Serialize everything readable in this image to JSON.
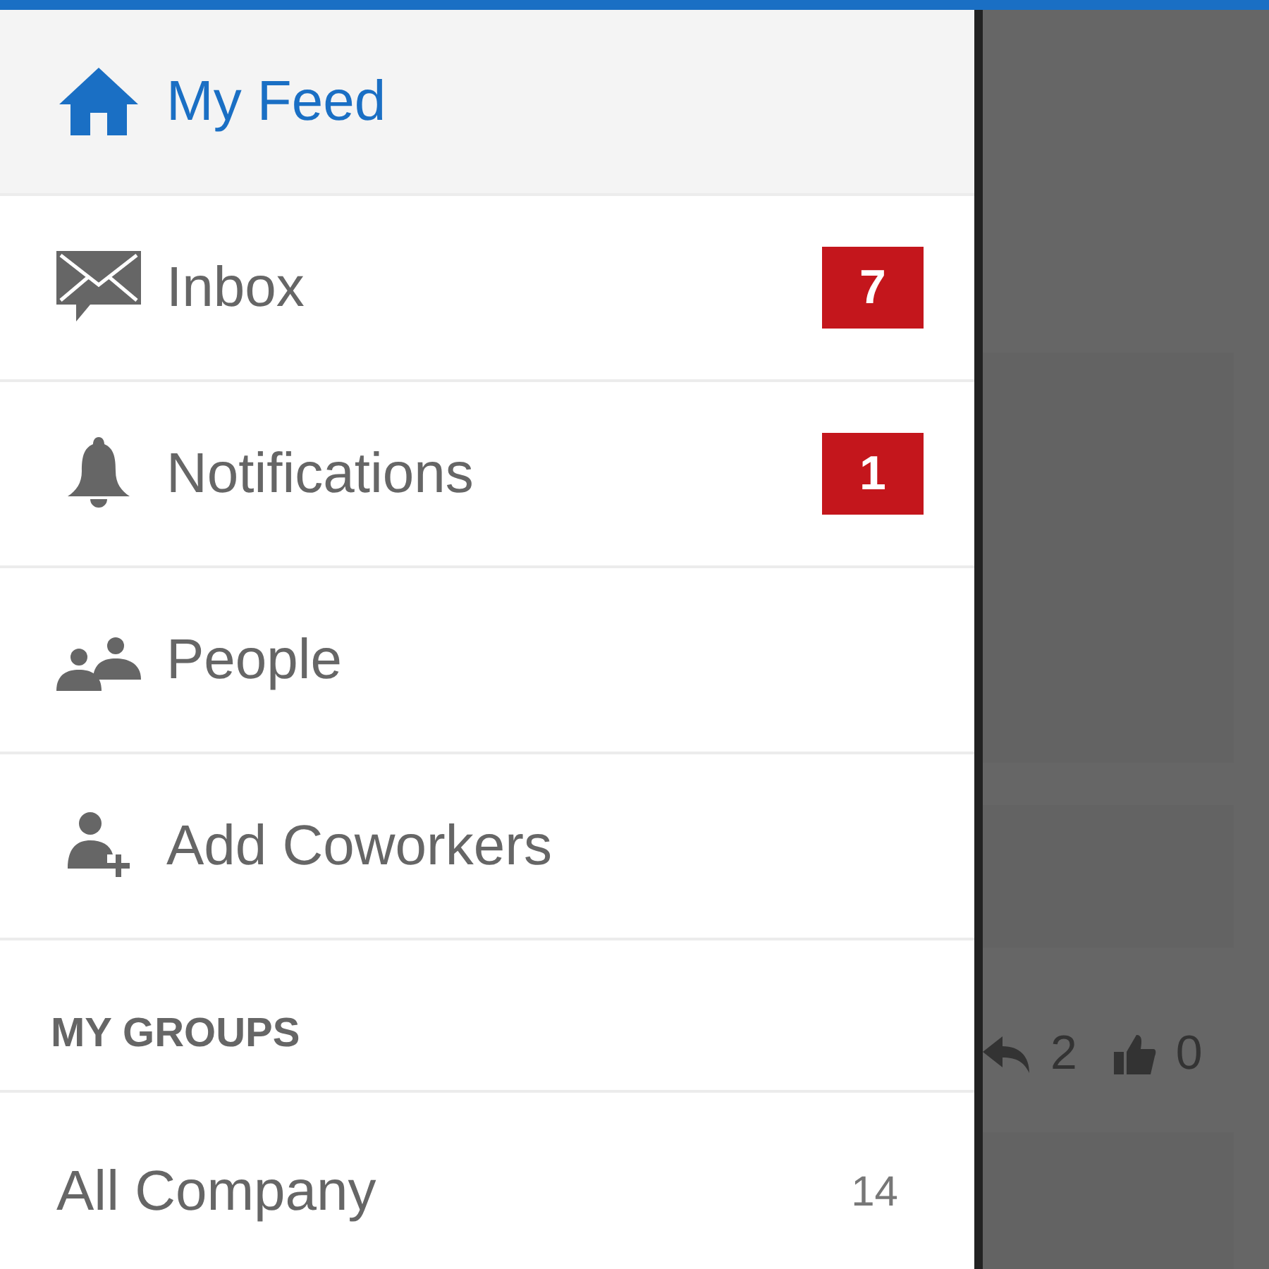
{
  "nav_items": [
    {
      "label": "My Feed",
      "selected": true
    },
    {
      "label": "Inbox",
      "selected": false,
      "badge": "7"
    },
    {
      "label": "Notifications",
      "selected": false,
      "badge": "1"
    },
    {
      "label": "People",
      "selected": false
    },
    {
      "label": "Add Coworkers",
      "selected": false
    }
  ],
  "groups_header": "MY GROUPS",
  "groups": [
    {
      "label": "All Company",
      "count": "14"
    }
  ],
  "background_post": {
    "replies": "2",
    "likes": "0"
  }
}
